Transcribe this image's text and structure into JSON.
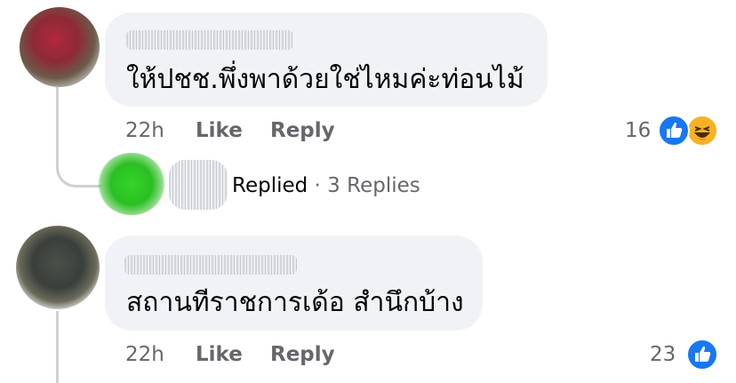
{
  "comments": [
    {
      "text": "ให้ปชช.พึ่งพาด้วยใช่ไหมค่ะท่อนไม้",
      "time": "22h",
      "like_label": "Like",
      "reply_label": "Reply",
      "reaction_count": "16",
      "reactions": [
        "like-icon",
        "haha-icon"
      ]
    },
    {
      "text": "สถานทีราชการเด้อ สำนึกบ้าง",
      "time": "22h",
      "like_label": "Like",
      "reply_label": "Reply",
      "reaction_count": "23",
      "reactions": [
        "like-icon"
      ]
    }
  ],
  "reply_summary": {
    "label": "Replied",
    "separator": "·",
    "count_text": "3 Replies"
  },
  "colors": {
    "bubble": "#f0f2f5",
    "meta_text": "#65676b",
    "like_blue": "#1877f2",
    "haha_yellow": "#f7b125"
  }
}
